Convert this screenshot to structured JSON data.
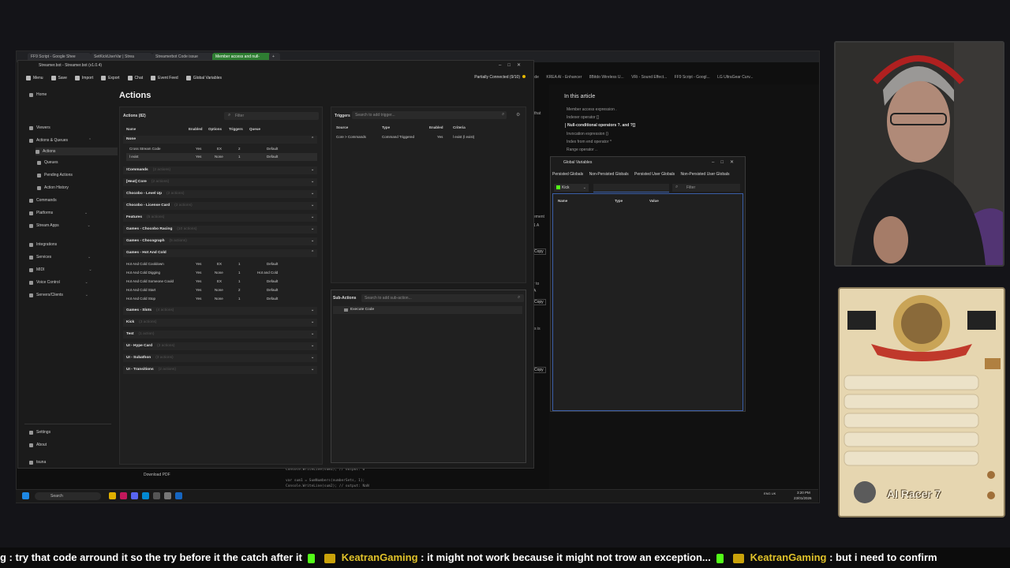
{
  "browser": {
    "tabs": [
      "FF9 Script - Google Shee",
      "SetKickUserVar | Strea",
      "Streamerbot Code issue",
      "Member access and null-"
    ],
    "bookmarks": [
      "Code",
      "KREA AI - Enhancer",
      "8Bitdo Wireless U...",
      "VRi - Sound Effect...",
      "FF9 Script - Googl...",
      "LG UltraGear Curv..."
    ]
  },
  "doc": {
    "heading": "In this article",
    "links": [
      "Member access expression .",
      "Indexer operator []",
      "Null-conditional operators ?. and ?[]",
      "Invocation expression ()",
      "Index from end operator ^",
      "Range operator .."
    ],
    "fragments": [
      "that",
      "ement",
      "1 A",
      "Copy",
      "r to",
      "A",
      "Copy",
      "is is",
      "Copy"
    ]
  },
  "code_snippet": [
    "Console.WriteLine(sum1); // output: 6",
    "var sum1 = SumNumbers(numberSets, 1);",
    "Console.WriteLine(sum2); // output: NaN"
  ],
  "streamerbot": {
    "window_title": "Streamer.bot - Streamer.bot (v1.0.4)",
    "menu": [
      "Menu",
      "Save",
      "Import",
      "Export",
      "Chat",
      "Event Feed",
      "Global Variables"
    ],
    "connection": "Partially Connected (9/10)",
    "nav": [
      {
        "label": "Home"
      },
      {
        "label": "Viewers"
      },
      {
        "label": "Actions & Queues"
      },
      {
        "label": "Actions"
      },
      {
        "label": "Queues"
      },
      {
        "label": "Pending Actions"
      },
      {
        "label": "Action History"
      },
      {
        "label": "Commands"
      },
      {
        "label": "Platforms"
      },
      {
        "label": "Stream Apps"
      },
      {
        "label": "Integrations"
      },
      {
        "label": "Services"
      },
      {
        "label": "MIDI"
      },
      {
        "label": "Voice Control"
      },
      {
        "label": "Servers/Clients"
      }
    ],
    "nav_bottom": [
      "Settings",
      "About",
      "tsuna"
    ],
    "page_title": "Actions",
    "actions": {
      "header": "Actions (82)",
      "filter_placeholder": "Filter",
      "columns": [
        "Name",
        "Enabled",
        "Options",
        "Triggers",
        "Queue"
      ],
      "groups": [
        {
          "name": "None",
          "open": true,
          "rows": [
            [
              "Cross Stream Code",
              "Yes",
              "EX",
              "2",
              "Default"
            ],
            [
              "l exist",
              "Yes",
              "None",
              "1",
              "Default"
            ]
          ]
        },
        {
          "name": "!Commands",
          "count": "(2 actions)"
        },
        {
          "name": "[Heat] Core",
          "count": "(2 actions)"
        },
        {
          "name": "Chocobo - Level Up",
          "count": "(2 actions)"
        },
        {
          "name": "Chocobo - License Card",
          "count": "(2 actions)"
        },
        {
          "name": "Features",
          "count": "(5 actions)"
        },
        {
          "name": "Games - Chocobo Racing",
          "count": "(10 actions)"
        },
        {
          "name": "Games - Chocograph",
          "count": "(5 actions)"
        },
        {
          "name": "Games - Hot And Cold",
          "open": true,
          "rows": [
            [
              "Hot And Cold Cooldown",
              "Yes",
              "EX",
              "1",
              "Default"
            ],
            [
              "Hot And Cold Digging",
              "Yes",
              "None",
              "1",
              "Hot and Cold"
            ],
            [
              "Hot And Cold Someone Could",
              "Yes",
              "EX",
              "1",
              "Default"
            ],
            [
              "Hot And Cold Start",
              "Yes",
              "None",
              "2",
              "Default"
            ],
            [
              "Hot And Cold Stop",
              "Yes",
              "None",
              "1",
              "Default"
            ]
          ]
        },
        {
          "name": "Games - Slots",
          "count": "(4 actions)"
        },
        {
          "name": "Kick",
          "count": "(3 actions)"
        },
        {
          "name": "Test",
          "count": "(1 action)"
        },
        {
          "name": "UI - Hype Card",
          "count": "(3 actions)"
        },
        {
          "name": "UI - Subathon",
          "count": "(3 actions)"
        },
        {
          "name": "UI - Transitions",
          "count": "(2 actions)"
        }
      ]
    },
    "triggers": {
      "header": "Triggers",
      "search_placeholder": "Search to add trigger...",
      "columns": [
        "Source",
        "Type",
        "Enabled",
        "Criteria"
      ],
      "rows": [
        [
          "Core > Commands",
          "Command Triggered",
          "Yes",
          "l exist (l exist)"
        ]
      ]
    },
    "subactions": {
      "header": "Sub-Actions",
      "search_placeholder": "Search to add sub-action...",
      "items": [
        "Execute Code"
      ]
    },
    "download": "Download PDF"
  },
  "global_vars": {
    "title": "Global Variables",
    "tabs": [
      "Persisted Globals",
      "Non-Persisted Globals",
      "Persisted User Globals",
      "Non-Persisted User Globals"
    ],
    "platform": "Kick",
    "filter_placeholder": "Filter",
    "columns": [
      "Name",
      "Type",
      "Value"
    ]
  },
  "taskbar": {
    "search": "Search",
    "lang": "ENG UK",
    "time": "3:20 PM",
    "date": "23/01/2026"
  },
  "overlay": {
    "card_name": "AI Racer 7"
  },
  "ticker": {
    "segments": [
      {
        "type": "msg",
        "text": "g : try that code arround it so the try before it the catch after it"
      },
      {
        "type": "user",
        "text": "KeatranGaming"
      },
      {
        "type": "msg",
        "text": ": it might not work because it might not trow an exception..."
      },
      {
        "type": "user",
        "text": "KeatranGaming"
      },
      {
        "type": "msg",
        "text": ": but i need to confirm"
      }
    ]
  }
}
